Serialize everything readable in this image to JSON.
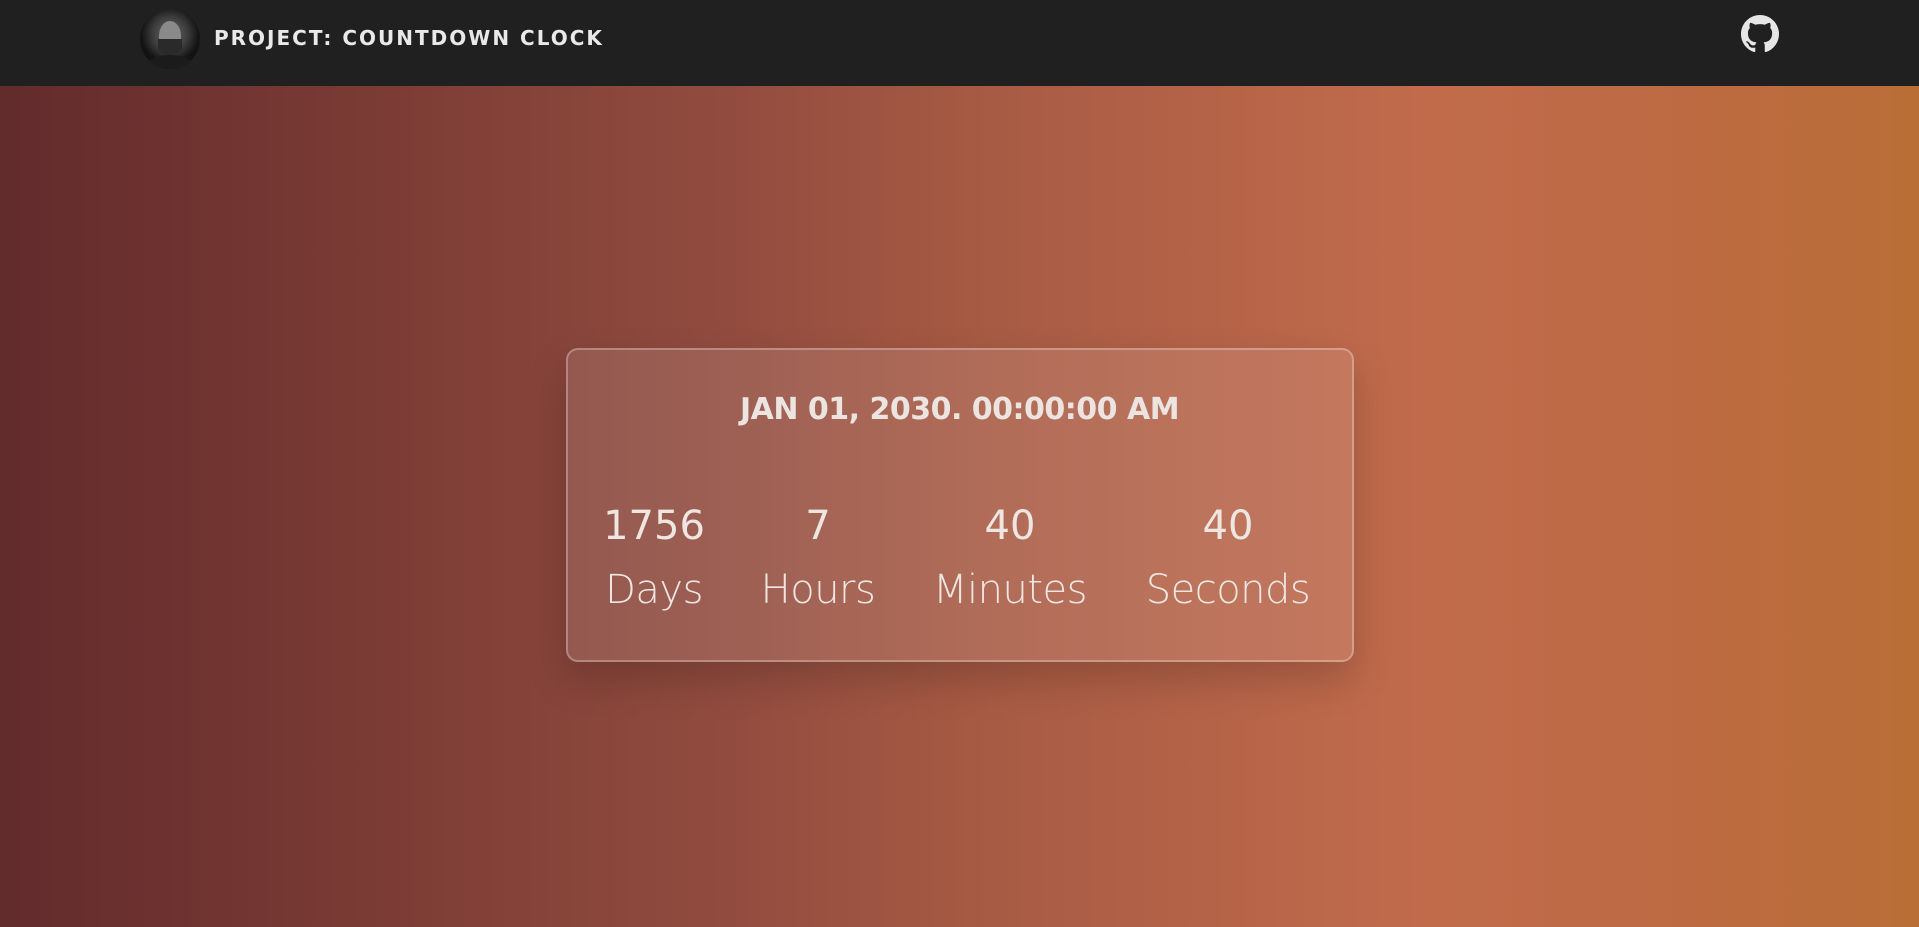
{
  "header": {
    "title": "PROJECT: COUNTDOWN CLOCK",
    "avatar_icon": "profile-photo",
    "github_icon": "github-icon"
  },
  "countdown": {
    "target": "JAN 01, 2030. 00:00:00 AM",
    "units": [
      {
        "value": "1756",
        "label": "Days"
      },
      {
        "value": "7",
        "label": "Hours"
      },
      {
        "value": "40",
        "label": "Minutes"
      },
      {
        "value": "40",
        "label": "Seconds"
      }
    ]
  },
  "colors": {
    "header_bg": "#202020",
    "gradient_start": "#622b2c",
    "gradient_mid": "#a85b44",
    "gradient_end": "#b96e36",
    "text_light": "#efe6e2"
  }
}
